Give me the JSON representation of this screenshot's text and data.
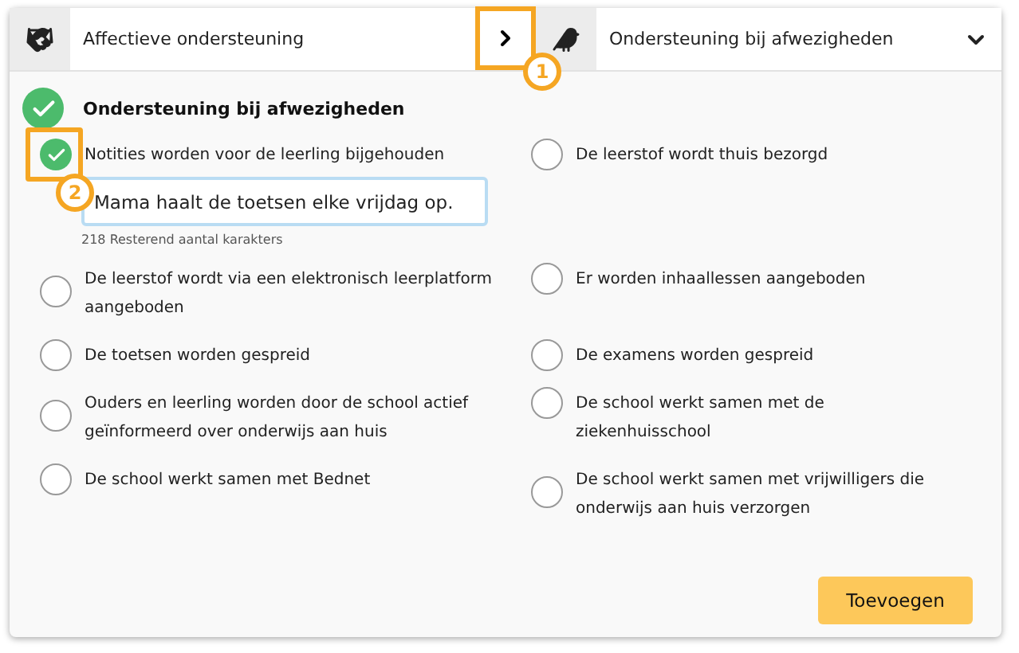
{
  "tabs": [
    {
      "label": "Affectieve ondersteuning"
    },
    {
      "label": "Ondersteuning bij afwezigheden",
      "expanded": true
    }
  ],
  "section": {
    "title": "Ondersteuning bij afwezigheden",
    "checked": true
  },
  "options": [
    {
      "label": "Notities worden voor de leerling bijgehouden",
      "checked": true,
      "note": {
        "value": "Mama haalt de toetsen elke vrijdag op.",
        "counter": "218 Resterend aantal karakters"
      }
    },
    {
      "label": "De leerstof wordt thuis bezorgd",
      "checked": false
    },
    {
      "label": "De leerstof wordt via een elektronisch leerplatform aangeboden",
      "checked": false
    },
    {
      "label": "Er worden inhaallessen aangeboden",
      "checked": false
    },
    {
      "label": "De toetsen worden gespreid",
      "checked": false
    },
    {
      "label": "De examens worden gespreid",
      "checked": false
    },
    {
      "label": "Ouders en leerling worden door de school actief geïnformeerd over onderwijs aan huis",
      "checked": false
    },
    {
      "label": "De school werkt samen met de ziekenhuisschool",
      "checked": false
    },
    {
      "label": "De school werkt samen met Bednet",
      "checked": false
    },
    {
      "label": "De school werkt samen met vrijwilligers die onderwijs aan huis verzorgen",
      "checked": false
    }
  ],
  "callouts": [
    {
      "label": "1"
    },
    {
      "label": "2"
    }
  ],
  "button": "Toevoegen"
}
